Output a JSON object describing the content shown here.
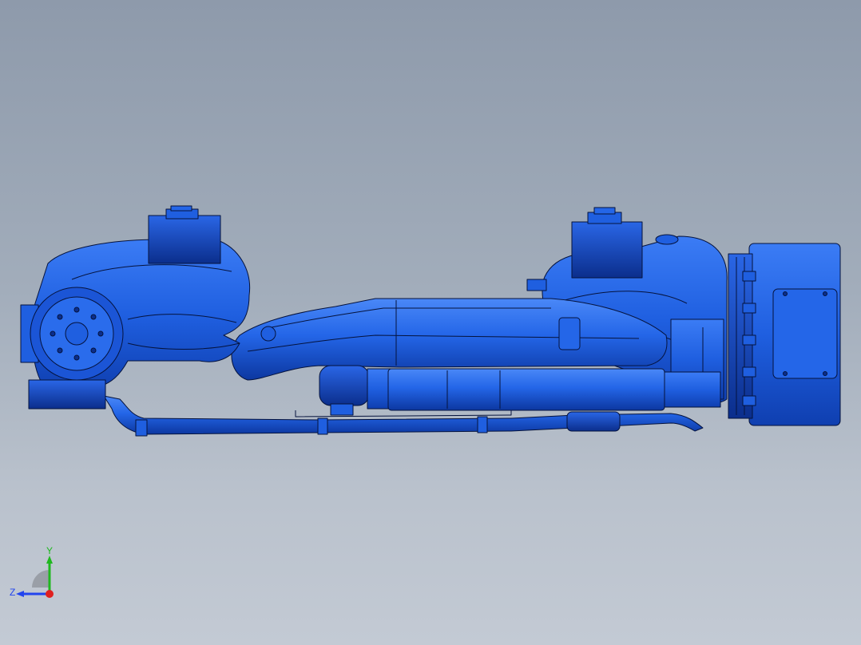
{
  "viewport": {
    "model_color": "#1e5be6",
    "background_top": "#8e9aab",
    "background_bottom": "#c3cad4"
  },
  "triad": {
    "y_label": "Y",
    "z_label": "Z",
    "y_color": "#1fb81f",
    "z_color": "#2244ee",
    "x_color": "#e02020"
  }
}
